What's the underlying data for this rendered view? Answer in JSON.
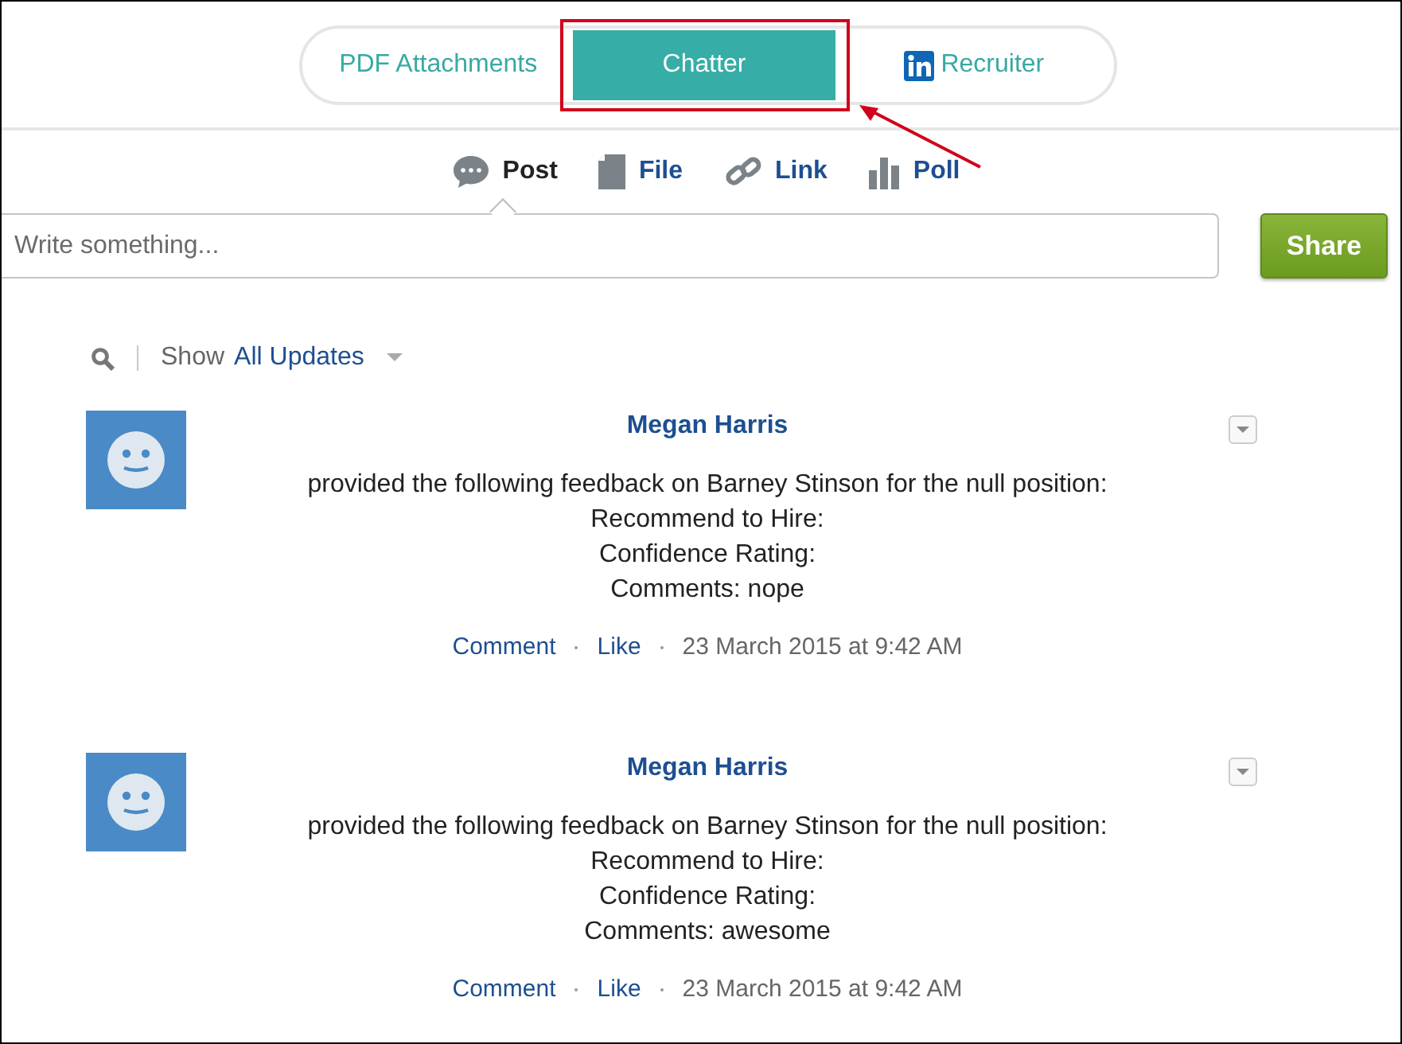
{
  "tabs": [
    {
      "label": "PDF Attachments",
      "selected": false,
      "kind": "text",
      "annotated": false
    },
    {
      "label": "Chatter",
      "selected": true,
      "kind": "text",
      "annotated": true
    },
    {
      "label": "Recruiter",
      "selected": false,
      "kind": "linkedin",
      "annotated": false
    }
  ],
  "publisher": {
    "actions": [
      {
        "label": "Post",
        "kind": "post",
        "selected": true
      },
      {
        "label": "File",
        "kind": "file",
        "selected": false
      },
      {
        "label": "Link",
        "kind": "link",
        "selected": false
      },
      {
        "label": "Poll",
        "kind": "poll",
        "selected": false
      }
    ],
    "input": {
      "placeholder": "Write something..."
    },
    "button": "Share"
  },
  "filter": {
    "label": "Show",
    "value": "All Updates"
  },
  "feed": [
    {
      "author": "Megan Harris",
      "lines": [
        "provided the following feedback on Barney Stinson for the null position:",
        "Recommend to Hire:",
        "Confidence Rating:",
        "Comments: nope"
      ],
      "actions": [
        "Comment",
        "Like"
      ],
      "timestamp": "23 March 2015 at 9:42 AM"
    },
    {
      "author": "Megan Harris",
      "lines": [
        "provided the following feedback on Barney Stinson for the null position:",
        "Recommend to Hire:",
        "Confidence Rating:",
        "Comments: awesome"
      ],
      "actions": [
        "Comment",
        "Like"
      ],
      "timestamp": "23 March 2015 at 9:42 AM"
    }
  ]
}
